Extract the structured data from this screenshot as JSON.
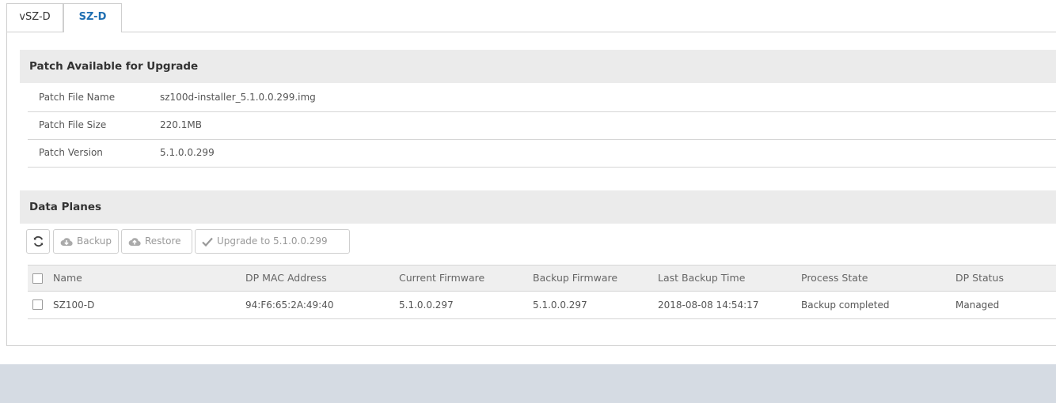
{
  "tabs": [
    {
      "label": "vSZ-D",
      "active": false
    },
    {
      "label": "SZ-D",
      "active": true
    }
  ],
  "patch": {
    "title": "Patch Available for Upgrade",
    "rows": [
      {
        "label": "Patch File Name",
        "value": "sz100d-installer_5.1.0.0.299.img"
      },
      {
        "label": "Patch File Size",
        "value": "220.1MB"
      },
      {
        "label": "Patch Version",
        "value": "5.1.0.0.299"
      }
    ]
  },
  "data_planes": {
    "title": "Data Planes",
    "toolbar": {
      "refresh_icon": "refresh-icon",
      "backup_label": "Backup",
      "restore_label": "Restore",
      "upgrade_label": "Upgrade to 5.1.0.0.299"
    },
    "columns": [
      "Name",
      "DP MAC Address",
      "Current Firmware",
      "Backup Firmware",
      "Last Backup Time",
      "Process State",
      "DP Status"
    ],
    "rows": [
      [
        "SZ100-D",
        "94:F6:65:2A:49:40",
        "5.1.0.0.297",
        "5.1.0.0.297",
        "2018-08-08 14:54:17",
        "Backup completed",
        "Managed"
      ]
    ]
  },
  "colors": {
    "active_tab": "#1f6fb2",
    "section_header_bg": "#ebebeb",
    "footer_bg": "#d5dbe3"
  }
}
